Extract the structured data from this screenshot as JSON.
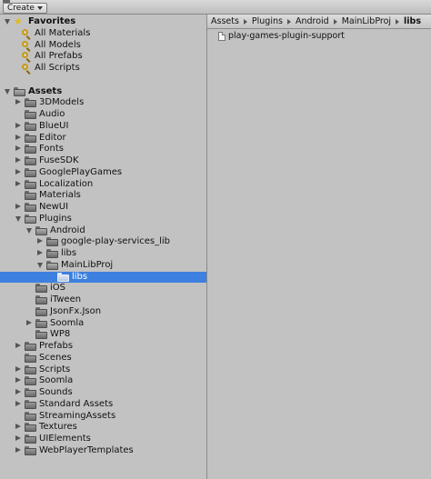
{
  "toolbar": {
    "create_label": "Create"
  },
  "breadcrumb": [
    "Assets",
    "Plugins",
    "Android",
    "MainLibProj",
    "libs"
  ],
  "content": {
    "items": [
      "play-games-plugin-support"
    ]
  },
  "colors": {
    "selection": "#3d80df",
    "panel": "#c2c2c2",
    "favorite_icon": "#c89a10"
  },
  "tree": [
    {
      "label": "Favorites",
      "depth": 0,
      "type": "section",
      "icon": "star-icon",
      "foldout": "open"
    },
    {
      "label": "All Materials",
      "depth": 1,
      "type": "search",
      "icon": "search-icon"
    },
    {
      "label": "All Models",
      "depth": 1,
      "type": "search",
      "icon": "search-icon"
    },
    {
      "label": "All Prefabs",
      "depth": 1,
      "type": "search",
      "icon": "search-icon"
    },
    {
      "label": "All Scripts",
      "depth": 1,
      "type": "search",
      "icon": "search-icon"
    },
    {
      "label": "",
      "depth": 0,
      "type": "spacer"
    },
    {
      "label": "Assets",
      "depth": 0,
      "type": "section",
      "icon": "folder-icon",
      "foldout": "open"
    },
    {
      "label": "3DModels",
      "depth": 1,
      "type": "folder",
      "foldout": "closed"
    },
    {
      "label": "Audio",
      "depth": 1,
      "type": "folder",
      "foldout": "none"
    },
    {
      "label": "BlueUI",
      "depth": 1,
      "type": "folder",
      "foldout": "closed"
    },
    {
      "label": "Editor",
      "depth": 1,
      "type": "folder",
      "foldout": "closed"
    },
    {
      "label": "Fonts",
      "depth": 1,
      "type": "folder",
      "foldout": "closed"
    },
    {
      "label": "FuseSDK",
      "depth": 1,
      "type": "folder",
      "foldout": "closed"
    },
    {
      "label": "GooglePlayGames",
      "depth": 1,
      "type": "folder",
      "foldout": "closed"
    },
    {
      "label": "Localization",
      "depth": 1,
      "type": "folder",
      "foldout": "closed"
    },
    {
      "label": "Materials",
      "depth": 1,
      "type": "folder",
      "foldout": "none"
    },
    {
      "label": "NewUI",
      "depth": 1,
      "type": "folder",
      "foldout": "closed"
    },
    {
      "label": "Plugins",
      "depth": 1,
      "type": "folder",
      "foldout": "open"
    },
    {
      "label": "Android",
      "depth": 2,
      "type": "folder",
      "foldout": "open"
    },
    {
      "label": "google-play-services_lib",
      "depth": 3,
      "type": "folder",
      "foldout": "closed"
    },
    {
      "label": "libs",
      "depth": 3,
      "type": "folder",
      "foldout": "closed"
    },
    {
      "label": "MainLibProj",
      "depth": 3,
      "type": "folder",
      "foldout": "open"
    },
    {
      "label": "libs",
      "depth": 4,
      "type": "folder",
      "foldout": "none",
      "selected": true
    },
    {
      "label": "iOS",
      "depth": 2,
      "type": "folder",
      "foldout": "none"
    },
    {
      "label": "iTween",
      "depth": 2,
      "type": "folder",
      "foldout": "none"
    },
    {
      "label": "JsonFx.Json",
      "depth": 2,
      "type": "folder",
      "foldout": "none"
    },
    {
      "label": "Soomla",
      "depth": 2,
      "type": "folder",
      "foldout": "closed"
    },
    {
      "label": "WP8",
      "depth": 2,
      "type": "folder",
      "foldout": "none"
    },
    {
      "label": "Prefabs",
      "depth": 1,
      "type": "folder",
      "foldout": "closed"
    },
    {
      "label": "Scenes",
      "depth": 1,
      "type": "folder",
      "foldout": "none"
    },
    {
      "label": "Scripts",
      "depth": 1,
      "type": "folder",
      "foldout": "closed"
    },
    {
      "label": "Soomla",
      "depth": 1,
      "type": "folder",
      "foldout": "closed"
    },
    {
      "label": "Sounds",
      "depth": 1,
      "type": "folder",
      "foldout": "closed"
    },
    {
      "label": "Standard Assets",
      "depth": 1,
      "type": "folder",
      "foldout": "closed"
    },
    {
      "label": "StreamingAssets",
      "depth": 1,
      "type": "folder",
      "foldout": "none"
    },
    {
      "label": "Textures",
      "depth": 1,
      "type": "folder",
      "foldout": "closed"
    },
    {
      "label": "UIElements",
      "depth": 1,
      "type": "folder",
      "foldout": "closed"
    },
    {
      "label": "WebPlayerTemplates",
      "depth": 1,
      "type": "folder",
      "foldout": "closed"
    }
  ]
}
